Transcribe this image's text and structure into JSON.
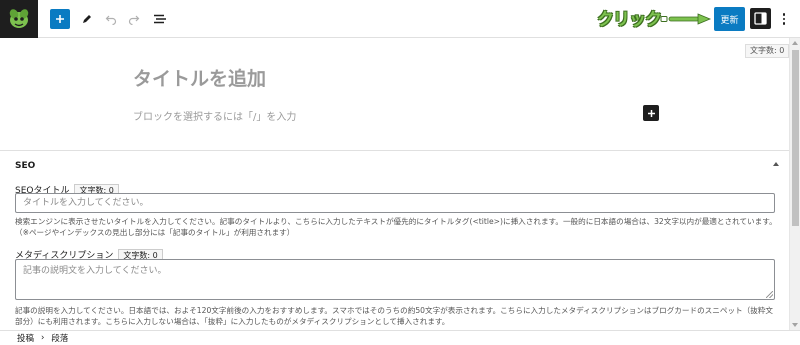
{
  "toolbar": {
    "annotation": "クリック",
    "update_label": "更新"
  },
  "editor": {
    "char_count": "文字数: 0",
    "title_placeholder": "タイトルを追加",
    "block_placeholder": "ブロックを選択するには「/」を入力"
  },
  "seo": {
    "heading": "SEO",
    "title_label": "SEOタイトル",
    "title_count": "文字数: 0",
    "title_placeholder": "タイトルを入力してください。",
    "title_help": "検索エンジンに表示させたいタイトルを入力してください。記事のタイトルより、こちらに入力したテキストが優先的にタイトルタグ(<title>)に挿入されます。一般的に日本語の場合は、32文字以内が最適とされています。（※ページやインデックスの見出し部分には「記事のタイトル」が利用されます）",
    "desc_label": "メタディスクリプション",
    "desc_count": "文字数: 0",
    "desc_placeholder": "記事の説明文を入力してください。",
    "desc_help": "記事の説明を入力してください。日本語では、およそ120文字前後の入力をおすすめします。スマホではそのうちの約50文字が表示されます。こちらに入力したメタディスクリプションはブログカードのスニペット（抜粋文部分）にも利用されます。こちらに入力しない場合は、「抜粋」に入力したものがメタディスクリプションとして挿入されます。"
  },
  "breadcrumb": {
    "items": [
      "投稿",
      "段落"
    ],
    "separator": "›"
  },
  "colors": {
    "accent": "#0a7bc2",
    "annotation_green": "#7dc24f"
  },
  "icons": [
    "plus-icon",
    "pen-icon",
    "undo-icon",
    "redo-icon",
    "list-view-icon",
    "settings-icon",
    "more-icon"
  ]
}
